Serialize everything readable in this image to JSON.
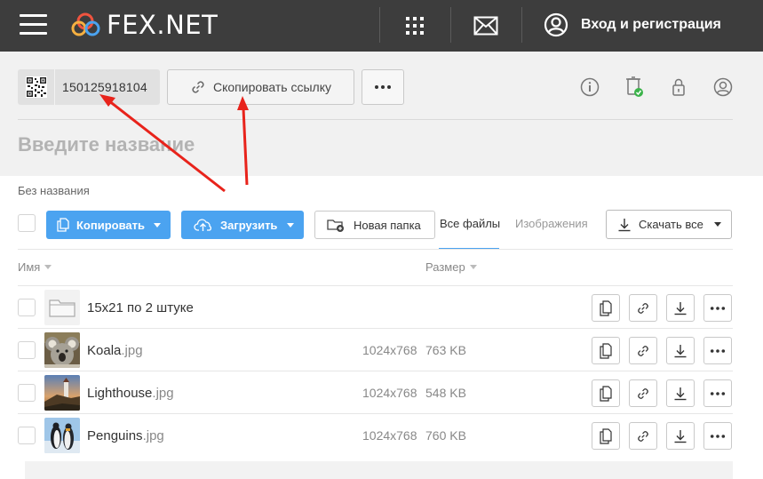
{
  "topbar": {
    "brand": "FEX.NET",
    "login_label": "Вход и регистрация",
    "icons": [
      "menu-icon",
      "apps-grid-icon",
      "mail-icon",
      "user-circle-icon"
    ]
  },
  "share_panel": {
    "file_id": "150125918104",
    "copy_link_label": "Скопировать ссылку",
    "title_placeholder": "Введите название",
    "icons": [
      "qr-code-icon",
      "link-icon",
      "more-icon",
      "info-icon",
      "storage-check-icon",
      "lock-icon",
      "user-icon"
    ]
  },
  "toolbar": {
    "folder_label": "Без названия",
    "copy_label": "Копировать",
    "upload_label": "Загрузить",
    "new_folder_label": "Новая папка",
    "tabs": [
      {
        "label": "Все файлы",
        "active": true
      },
      {
        "label": "Изображения",
        "active": false
      }
    ],
    "download_all_label": "Скачать все",
    "accent_color": "#4ba3f0"
  },
  "columns": {
    "name": "Имя",
    "size": "Размер"
  },
  "files": [
    {
      "name": "15x21 по 2 штуке",
      "ext": "",
      "dims": "",
      "size": "",
      "type": "folder"
    },
    {
      "name": "Koala",
      "ext": ".jpg",
      "dims": "1024x768",
      "size": "763 KB",
      "type": "image",
      "thumb": "koala"
    },
    {
      "name": "Lighthouse",
      "ext": ".jpg",
      "dims": "1024x768",
      "size": "548 KB",
      "type": "image",
      "thumb": "lighthouse"
    },
    {
      "name": "Penguins",
      "ext": ".jpg",
      "dims": "1024x768",
      "size": "760 KB",
      "type": "image",
      "thumb": "penguins"
    }
  ],
  "row_actions": [
    "copy-icon",
    "link-icon",
    "download-icon",
    "more-icon"
  ],
  "annotation_color": "#e8231b"
}
